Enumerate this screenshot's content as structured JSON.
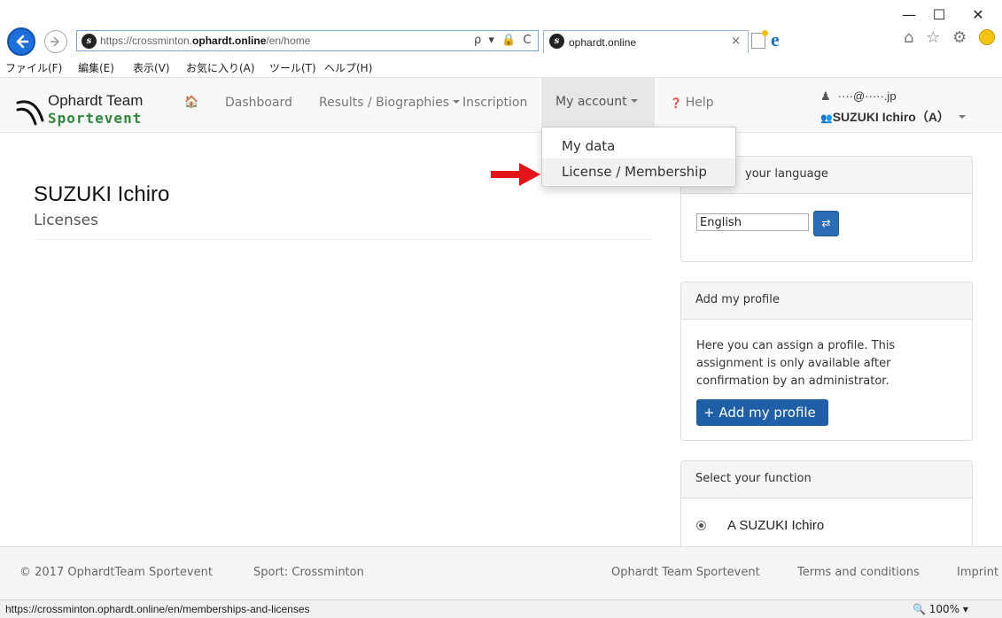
{
  "browser": {
    "url_prefix": "https://crossminton.",
    "url_domain": "ophardt.online",
    "url_path": "/en/home",
    "address_tools": "ρ ▾ 🔒 C",
    "tab_title": "ophardt.online",
    "tab_close": "×",
    "menus": [
      "ファイル(F)",
      "編集(E)",
      "表示(V)",
      "お気に入り(A)",
      "ツール(T)",
      "ヘルプ(H)"
    ],
    "window_controls": [
      "—",
      "☐",
      "✕"
    ],
    "right_icons": "⌂ ☆ ⚙"
  },
  "site": {
    "logo_line1": "Ophardt Team",
    "logo_line2": "Sportevent",
    "nav": {
      "dashboard": "Dashboard",
      "results": "Results / Biographies",
      "inscription": "Inscription",
      "my_account": "My account",
      "help": "Help"
    },
    "user_email": "····@·····.jp",
    "user_role": "SUZUKI Ichiro（A）"
  },
  "dropdown": {
    "items": [
      "My data",
      "License / Membership"
    ]
  },
  "main": {
    "title": "SUZUKI Ichiro",
    "subtitle": "Licenses"
  },
  "sidebar": {
    "language_head": "your language",
    "language_value": "English",
    "profile_head": "Add my profile",
    "profile_text": "Here you can assign a profile. This assignment is only available after confirmation by an administrator.",
    "profile_button": "+ Add my profile",
    "function_head": "Select your function",
    "function_option": "A   SUZUKI Ichiro"
  },
  "footer": {
    "copyright": "© 2017 OphardtTeam Sportevent",
    "sport": "Sport: Crossminton",
    "link1": "Ophardt Team Sportevent",
    "link2": "Terms and conditions",
    "link3": "Imprint"
  },
  "status": {
    "url": "https://crossminton.ophardt.online/en/memberships-and-licenses",
    "zoom": "🔍 100%  ▾"
  },
  "colors": {
    "accent_blue": "#1f5fa8",
    "logo_green": "#2d8a3b",
    "arrow_red": "#e5141b"
  }
}
